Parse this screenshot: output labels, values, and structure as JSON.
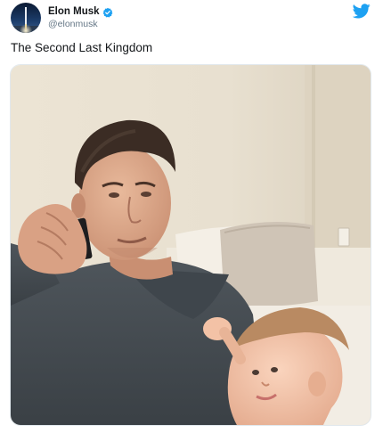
{
  "author": {
    "display_name": "Elon Musk",
    "handle": "@elonmusk",
    "verified": true,
    "avatar_icon": "rocket-launch-avatar",
    "brand_icon": "twitter-bird-icon"
  },
  "tweet": {
    "text": "The Second Last Kingdom"
  },
  "colors": {
    "brand_blue": "#1da1f2",
    "text_primary": "#14171a",
    "text_secondary": "#657786"
  }
}
